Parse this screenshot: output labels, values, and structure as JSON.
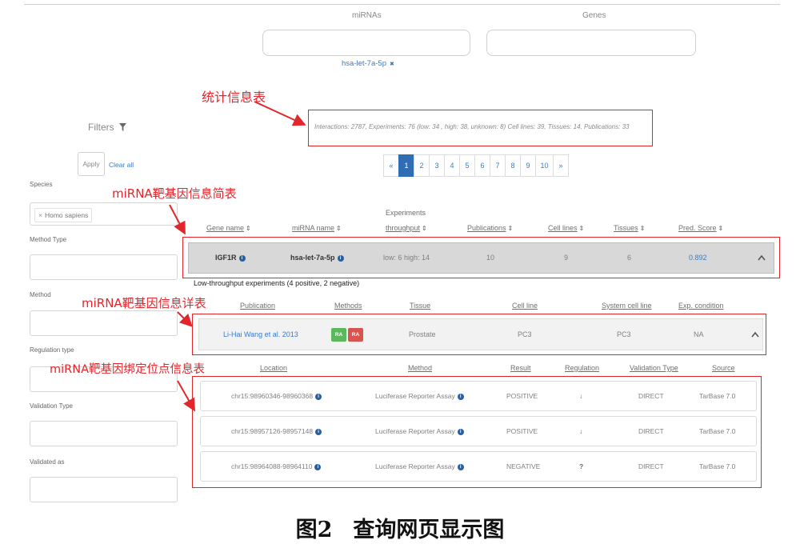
{
  "search": {
    "mirnas_label": "miRNAs",
    "genes_label": "Genes",
    "selected_mirna": "hsa-let-7a-5p"
  },
  "annotations": {
    "stats": "统计信息表",
    "summary": "miRNA靶基因信息简表",
    "detail": "miRNA靶基因信息详表",
    "binding": "miRNA靶基因绑定位点信息表"
  },
  "stats": {
    "text": "Interactions: 2787, Experiments: 76 (low: 34 , high: 38, unknown: 8) Cell lines: 39, Tissues: 14, Publications: 33"
  },
  "filters": {
    "title": "Filters",
    "apply_label": "Apply",
    "clear_label": "Clear all",
    "fields": [
      {
        "label": "Species",
        "value": "Homo sapiens"
      },
      {
        "label": "Method Type"
      },
      {
        "label": "Method"
      },
      {
        "label": "Regulation type"
      },
      {
        "label": "Validation Type"
      },
      {
        "label": "Validated as"
      }
    ]
  },
  "pagination": {
    "prev": "«",
    "pages": [
      "1",
      "2",
      "3",
      "4",
      "5",
      "6",
      "7",
      "8",
      "9",
      "10"
    ],
    "next": "»",
    "current": 1
  },
  "summary_table": {
    "group_header": "Experiments",
    "columns": [
      "Gene name",
      "miRNA name",
      "throughput",
      "Publications",
      "Cell lines",
      "Tissues",
      "Pred. Score"
    ],
    "row": {
      "gene": "IGF1R",
      "mirna": "hsa-let-7a-5p",
      "throughput": "low: 6 high: 14",
      "publications": "10",
      "cell_lines": "9",
      "tissues": "6",
      "pred_score": "0.892"
    }
  },
  "experiments": {
    "title": "Low-throughput experiments (4 positive, 2 negative)",
    "columns": [
      "Publication",
      "Methods",
      "Tissue",
      "Cell line",
      "System cell line",
      "Exp. condition"
    ],
    "row": {
      "publication": "Li-Hai Wang et al. 2013",
      "methods": [
        {
          "label": "RA",
          "color": "#5cb85c"
        },
        {
          "label": "RA",
          "color": "#d9534f"
        }
      ],
      "tissue": "Prostate",
      "cell_line": "PC3",
      "system_cell_line": "PC3",
      "exp_condition": "NA"
    }
  },
  "binding_sites": {
    "columns": [
      "Location",
      "Method",
      "Result",
      "Regulation",
      "Validation Type",
      "Source"
    ],
    "rows": [
      {
        "location": "chr15:98960346-98960368",
        "method": "Luciferase Reporter Assay",
        "result": "POSITIVE",
        "regulation_icon": "arrow-down-icon",
        "validation_type": "DIRECT",
        "source": "TarBase 7.0"
      },
      {
        "location": "chr15:98957126-98957148",
        "method": "Luciferase Reporter Assay",
        "result": "POSITIVE",
        "regulation_icon": "arrow-down-icon",
        "validation_type": "DIRECT",
        "source": "TarBase 7.0"
      },
      {
        "location": "chr15:98964088-98964110",
        "method": "Luciferase Reporter Assay",
        "result": "NEGATIVE",
        "regulation_icon": "question-icon",
        "validation_type": "DIRECT",
        "source": "TarBase 7.0"
      }
    ]
  },
  "colors": {
    "accent": "#2f6db5",
    "link": "#3a7bc8",
    "annotation": "#e3262c",
    "summary_row_bg": "#d8d8d8"
  },
  "figure_caption": {
    "label": "图2",
    "title": "查询网页显示图"
  }
}
